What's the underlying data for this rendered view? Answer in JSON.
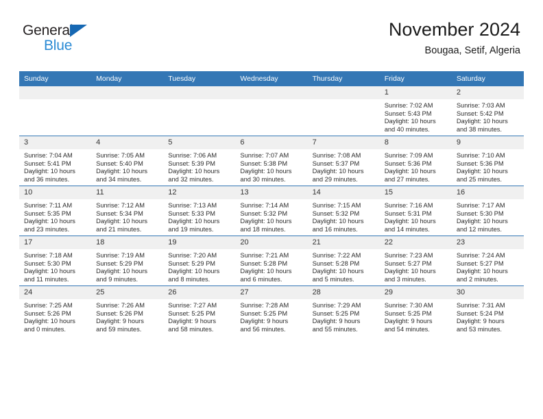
{
  "brand": {
    "name_part1": "General",
    "name_part2": "Blue",
    "accent_color": "#2a8ad4",
    "triangle_color": "#1668b3"
  },
  "header": {
    "title": "November 2024",
    "subtitle": "Bougaa, Setif, Algeria"
  },
  "calendar": {
    "header_background": "#3477b5",
    "daynum_background": "#f0f0f0",
    "weekdays": [
      "Sunday",
      "Monday",
      "Tuesday",
      "Wednesday",
      "Thursday",
      "Friday",
      "Saturday"
    ],
    "weeks": [
      [
        {
          "day": "",
          "lines": []
        },
        {
          "day": "",
          "lines": []
        },
        {
          "day": "",
          "lines": []
        },
        {
          "day": "",
          "lines": []
        },
        {
          "day": "",
          "lines": []
        },
        {
          "day": "1",
          "lines": [
            "Sunrise: 7:02 AM",
            "Sunset: 5:43 PM",
            "Daylight: 10 hours",
            "and 40 minutes."
          ]
        },
        {
          "day": "2",
          "lines": [
            "Sunrise: 7:03 AM",
            "Sunset: 5:42 PM",
            "Daylight: 10 hours",
            "and 38 minutes."
          ]
        }
      ],
      [
        {
          "day": "3",
          "lines": [
            "Sunrise: 7:04 AM",
            "Sunset: 5:41 PM",
            "Daylight: 10 hours",
            "and 36 minutes."
          ]
        },
        {
          "day": "4",
          "lines": [
            "Sunrise: 7:05 AM",
            "Sunset: 5:40 PM",
            "Daylight: 10 hours",
            "and 34 minutes."
          ]
        },
        {
          "day": "5",
          "lines": [
            "Sunrise: 7:06 AM",
            "Sunset: 5:39 PM",
            "Daylight: 10 hours",
            "and 32 minutes."
          ]
        },
        {
          "day": "6",
          "lines": [
            "Sunrise: 7:07 AM",
            "Sunset: 5:38 PM",
            "Daylight: 10 hours",
            "and 30 minutes."
          ]
        },
        {
          "day": "7",
          "lines": [
            "Sunrise: 7:08 AM",
            "Sunset: 5:37 PM",
            "Daylight: 10 hours",
            "and 29 minutes."
          ]
        },
        {
          "day": "8",
          "lines": [
            "Sunrise: 7:09 AM",
            "Sunset: 5:36 PM",
            "Daylight: 10 hours",
            "and 27 minutes."
          ]
        },
        {
          "day": "9",
          "lines": [
            "Sunrise: 7:10 AM",
            "Sunset: 5:36 PM",
            "Daylight: 10 hours",
            "and 25 minutes."
          ]
        }
      ],
      [
        {
          "day": "10",
          "lines": [
            "Sunrise: 7:11 AM",
            "Sunset: 5:35 PM",
            "Daylight: 10 hours",
            "and 23 minutes."
          ]
        },
        {
          "day": "11",
          "lines": [
            "Sunrise: 7:12 AM",
            "Sunset: 5:34 PM",
            "Daylight: 10 hours",
            "and 21 minutes."
          ]
        },
        {
          "day": "12",
          "lines": [
            "Sunrise: 7:13 AM",
            "Sunset: 5:33 PM",
            "Daylight: 10 hours",
            "and 19 minutes."
          ]
        },
        {
          "day": "13",
          "lines": [
            "Sunrise: 7:14 AM",
            "Sunset: 5:32 PM",
            "Daylight: 10 hours",
            "and 18 minutes."
          ]
        },
        {
          "day": "14",
          "lines": [
            "Sunrise: 7:15 AM",
            "Sunset: 5:32 PM",
            "Daylight: 10 hours",
            "and 16 minutes."
          ]
        },
        {
          "day": "15",
          "lines": [
            "Sunrise: 7:16 AM",
            "Sunset: 5:31 PM",
            "Daylight: 10 hours",
            "and 14 minutes."
          ]
        },
        {
          "day": "16",
          "lines": [
            "Sunrise: 7:17 AM",
            "Sunset: 5:30 PM",
            "Daylight: 10 hours",
            "and 12 minutes."
          ]
        }
      ],
      [
        {
          "day": "17",
          "lines": [
            "Sunrise: 7:18 AM",
            "Sunset: 5:30 PM",
            "Daylight: 10 hours",
            "and 11 minutes."
          ]
        },
        {
          "day": "18",
          "lines": [
            "Sunrise: 7:19 AM",
            "Sunset: 5:29 PM",
            "Daylight: 10 hours",
            "and 9 minutes."
          ]
        },
        {
          "day": "19",
          "lines": [
            "Sunrise: 7:20 AM",
            "Sunset: 5:29 PM",
            "Daylight: 10 hours",
            "and 8 minutes."
          ]
        },
        {
          "day": "20",
          "lines": [
            "Sunrise: 7:21 AM",
            "Sunset: 5:28 PM",
            "Daylight: 10 hours",
            "and 6 minutes."
          ]
        },
        {
          "day": "21",
          "lines": [
            "Sunrise: 7:22 AM",
            "Sunset: 5:28 PM",
            "Daylight: 10 hours",
            "and 5 minutes."
          ]
        },
        {
          "day": "22",
          "lines": [
            "Sunrise: 7:23 AM",
            "Sunset: 5:27 PM",
            "Daylight: 10 hours",
            "and 3 minutes."
          ]
        },
        {
          "day": "23",
          "lines": [
            "Sunrise: 7:24 AM",
            "Sunset: 5:27 PM",
            "Daylight: 10 hours",
            "and 2 minutes."
          ]
        }
      ],
      [
        {
          "day": "24",
          "lines": [
            "Sunrise: 7:25 AM",
            "Sunset: 5:26 PM",
            "Daylight: 10 hours",
            "and 0 minutes."
          ]
        },
        {
          "day": "25",
          "lines": [
            "Sunrise: 7:26 AM",
            "Sunset: 5:26 PM",
            "Daylight: 9 hours",
            "and 59 minutes."
          ]
        },
        {
          "day": "26",
          "lines": [
            "Sunrise: 7:27 AM",
            "Sunset: 5:25 PM",
            "Daylight: 9 hours",
            "and 58 minutes."
          ]
        },
        {
          "day": "27",
          "lines": [
            "Sunrise: 7:28 AM",
            "Sunset: 5:25 PM",
            "Daylight: 9 hours",
            "and 56 minutes."
          ]
        },
        {
          "day": "28",
          "lines": [
            "Sunrise: 7:29 AM",
            "Sunset: 5:25 PM",
            "Daylight: 9 hours",
            "and 55 minutes."
          ]
        },
        {
          "day": "29",
          "lines": [
            "Sunrise: 7:30 AM",
            "Sunset: 5:25 PM",
            "Daylight: 9 hours",
            "and 54 minutes."
          ]
        },
        {
          "day": "30",
          "lines": [
            "Sunrise: 7:31 AM",
            "Sunset: 5:24 PM",
            "Daylight: 9 hours",
            "and 53 minutes."
          ]
        }
      ]
    ]
  }
}
